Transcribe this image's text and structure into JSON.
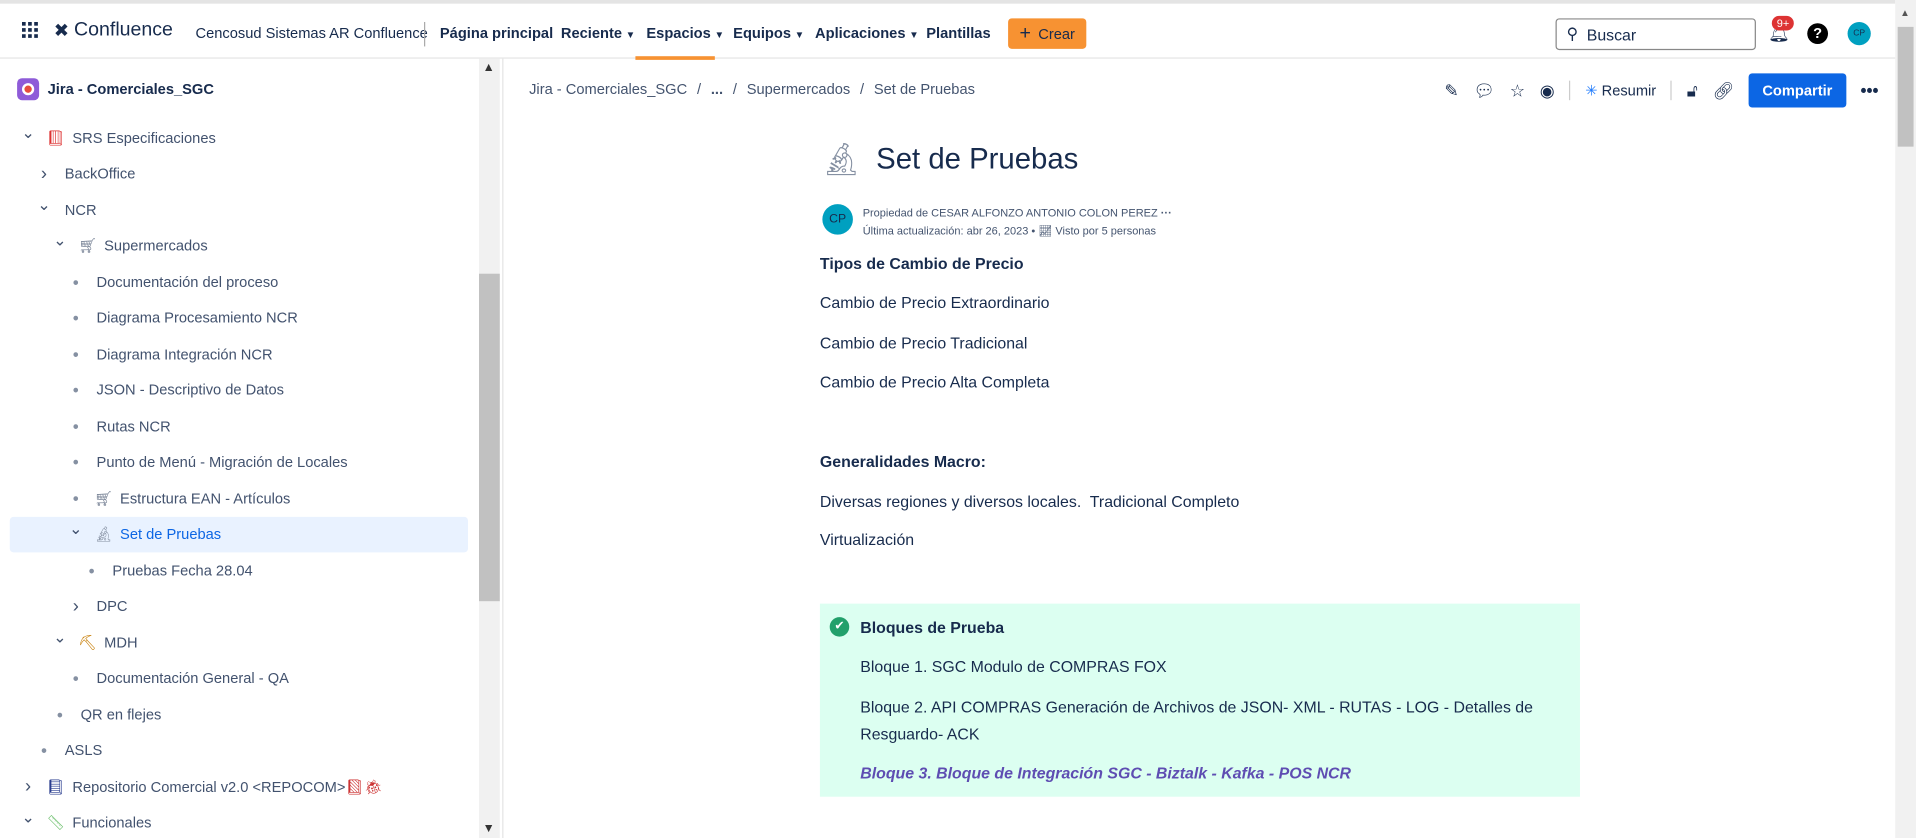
{
  "topbar": {
    "app_name": "Confluence",
    "site_name": "Cencosud Sistemas AR Confluence",
    "nav": [
      {
        "label": "Página principal",
        "dropdown": false
      },
      {
        "label": "Reciente",
        "dropdown": true
      },
      {
        "label": "Espacios",
        "dropdown": true,
        "active": true
      },
      {
        "label": "Equipos",
        "dropdown": true
      },
      {
        "label": "Aplicaciones",
        "dropdown": true
      },
      {
        "label": "Plantillas",
        "dropdown": false
      }
    ],
    "create_label": "Crear",
    "search_placeholder": "Buscar",
    "notifications_badge": "9+",
    "avatar_initials": "CP",
    "accent_color": "#f79232"
  },
  "sidebar": {
    "space_name": "Jira - Comerciales_SGC",
    "tree": [
      {
        "label": "SRS Especificaciones",
        "level": 0,
        "toggle": "expanded",
        "icon": "book-icon"
      },
      {
        "label": "BackOffice",
        "level": 1,
        "toggle": "collapsed"
      },
      {
        "label": "NCR",
        "level": 1,
        "toggle": "expanded"
      },
      {
        "label": "Supermercados",
        "level": 2,
        "toggle": "expanded",
        "icon": "cart-icon"
      },
      {
        "label": "Documentación del proceso",
        "level": 3,
        "toggle": "bullet"
      },
      {
        "label": "Diagrama Procesamiento NCR",
        "level": 3,
        "toggle": "bullet"
      },
      {
        "label": "Diagrama Integración NCR",
        "level": 3,
        "toggle": "bullet"
      },
      {
        "label": "JSON - Descriptivo de Datos",
        "level": 3,
        "toggle": "bullet"
      },
      {
        "label": "Rutas NCR",
        "level": 3,
        "toggle": "bullet"
      },
      {
        "label": "Punto de Menú - Migración de Locales",
        "level": 3,
        "toggle": "bullet"
      },
      {
        "label": "Estructura EAN - Artículos",
        "level": 3,
        "toggle": "bullet",
        "icon": "cart-icon"
      },
      {
        "label": "Set de Pruebas",
        "level": 3,
        "toggle": "expanded",
        "icon": "microscope-icon",
        "selected": true
      },
      {
        "label": "Pruebas Fecha 28.04",
        "level": 4,
        "toggle": "bullet"
      },
      {
        "label": "DPC",
        "level": 3,
        "toggle": "collapsed"
      },
      {
        "label": "MDH",
        "level": 2,
        "toggle": "expanded",
        "icon": "pick-icon"
      },
      {
        "label": "Documentación General - QA",
        "level": 3,
        "toggle": "bullet"
      },
      {
        "label": "QR en flejes",
        "level": 2,
        "toggle": "bullet"
      },
      {
        "label": "ASLS",
        "level": 1,
        "toggle": "bullet"
      },
      {
        "label": "Repositorio Comercial v2.0 <REPOCOM>",
        "level": 0,
        "toggle": "collapsed",
        "icon": "notebook-icon"
      },
      {
        "label": "Funcionales",
        "level": 0,
        "toggle": "expanded",
        "icon": "ruler-icon"
      }
    ]
  },
  "page": {
    "breadcrumb": [
      "Jira - Comerciales_SGC",
      "...",
      "Supermercados",
      "Set de Pruebas"
    ],
    "actions": {
      "summarize_label": "Resumir",
      "share_label": "Compartir"
    },
    "title": "Set de Pruebas",
    "owner": "Propiedad de CESAR ALFONZO ANTONIO COLON PEREZ",
    "updated": "Última actualización: abr 26, 2023",
    "views": "Visto por 5 personas",
    "owner_initials": "CP",
    "sections": {
      "h1": "Tipos de Cambio de Precio",
      "items1": [
        "Cambio de Precio Extraordinario",
        "Cambio de Precio Tradicional",
        "Cambio de Precio Alta Completa"
      ],
      "h2": "Generalidades Macro:",
      "items2": [
        "Diversas regiones y diversos locales.  Tradicional Completo",
        "Virtualización"
      ]
    },
    "panel": {
      "title": "Bloques de Prueba",
      "items": [
        "Bloque 1. SGC Modulo de COMPRAS FOX",
        "Bloque 2. API COMPRAS Generación de Archivos de JSON- XML - RUTAS - LOG - Detalles de Resguardo- ACK",
        "Bloque 3. Bloque de Integración SGC - Biztalk - Kafka - POS NCR"
      ],
      "color": "#dcfff1"
    }
  }
}
